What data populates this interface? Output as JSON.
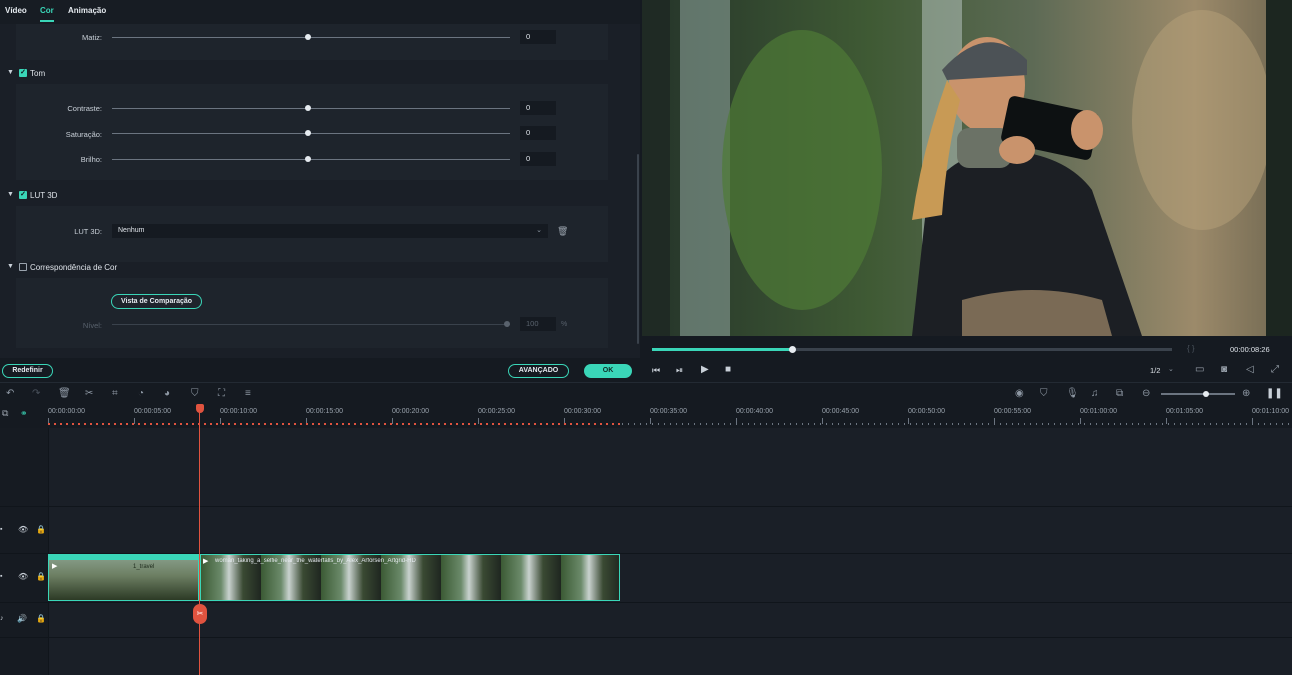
{
  "tabs": [
    {
      "label": "Vídeo"
    },
    {
      "label": "Cor",
      "active": true
    },
    {
      "label": "Animação"
    }
  ],
  "color_panel": {
    "matiz": {
      "label": "Matiz:",
      "value": "0"
    },
    "tom": {
      "title": "Tom",
      "checked": true,
      "contraste": {
        "label": "Contraste:",
        "value": "0"
      },
      "saturacao": {
        "label": "Saturação:",
        "value": "0"
      },
      "brilho": {
        "label": "Brilho:",
        "value": "0"
      }
    },
    "lut": {
      "title": "LUT 3D",
      "checked": true,
      "field_label": "LUT 3D:",
      "selected": "Nenhum"
    },
    "correspondencia": {
      "title": "Correspondência de Cor",
      "checked": false,
      "compare_button": "Vista de Comparação",
      "nivel_label": "Nível:",
      "nivel_value": "100",
      "nivel_unit": "%"
    }
  },
  "buttons": {
    "redefinir": "Redefinir",
    "avancado": "AVANÇADO",
    "ok": "OK"
  },
  "preview": {
    "timecode": "00:00:08:26",
    "quality": "1/2",
    "progress": 0.27,
    "brackets": "{     }"
  },
  "ruler": {
    "labels": [
      "00:00:00:00",
      "00:00:05:00",
      "00:00:10:00",
      "00:00:15:00",
      "00:00:20:00",
      "00:00:25:00",
      "00:00:30:00",
      "00:00:35:00",
      "00:00:40:00",
      "00:00:45:00",
      "00:00:50:00",
      "00:00:55:00",
      "00:01:00:00",
      "00:01:05:00",
      "00:01:10:00"
    ]
  },
  "timeline": {
    "clip_name": "woman_taking_a_selfie_near_the_waterfalls_by_Alex_Arforsen_Artgrid-HD",
    "clip1_label": "1_travel"
  },
  "colors": {
    "accent": "#3ad6b8",
    "playhead": "#e0533f"
  }
}
